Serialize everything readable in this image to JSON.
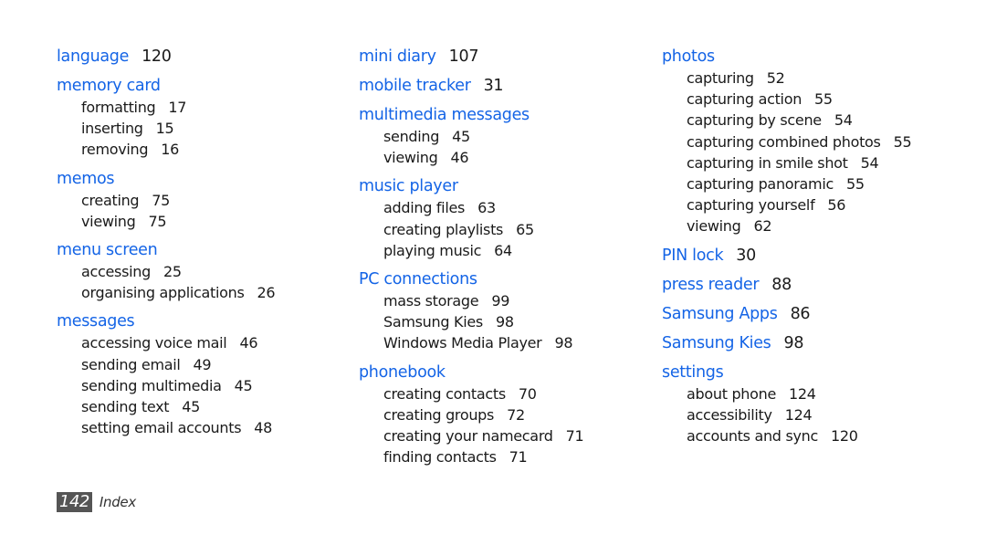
{
  "columns": [
    [
      {
        "term": "language",
        "page": "120",
        "subs": []
      },
      {
        "term": "memory card",
        "page": "",
        "subs": [
          {
            "term": "formatting",
            "page": "17"
          },
          {
            "term": "inserting",
            "page": "15"
          },
          {
            "term": "removing",
            "page": "16"
          }
        ]
      },
      {
        "term": "memos",
        "page": "",
        "subs": [
          {
            "term": "creating",
            "page": "75"
          },
          {
            "term": "viewing",
            "page": "75"
          }
        ]
      },
      {
        "term": "menu screen",
        "page": "",
        "subs": [
          {
            "term": "accessing",
            "page": "25"
          },
          {
            "term": "organising applications",
            "page": "26"
          }
        ]
      },
      {
        "term": "messages",
        "page": "",
        "subs": [
          {
            "term": "accessing voice mail",
            "page": "46"
          },
          {
            "term": "sending email",
            "page": "49"
          },
          {
            "term": "sending multimedia",
            "page": "45"
          },
          {
            "term": "sending text",
            "page": "45"
          },
          {
            "term": "setting email accounts",
            "page": "48"
          }
        ]
      }
    ],
    [
      {
        "term": "mini diary",
        "page": "107",
        "subs": []
      },
      {
        "term": "mobile tracker",
        "page": "31",
        "subs": []
      },
      {
        "term": "multimedia messages",
        "page": "",
        "subs": [
          {
            "term": "sending",
            "page": "45"
          },
          {
            "term": "viewing",
            "page": "46"
          }
        ]
      },
      {
        "term": "music player",
        "page": "",
        "subs": [
          {
            "term": "adding files",
            "page": "63"
          },
          {
            "term": "creating playlists",
            "page": "65"
          },
          {
            "term": "playing music",
            "page": "64"
          }
        ]
      },
      {
        "term": "PC connections",
        "page": "",
        "subs": [
          {
            "term": "mass storage",
            "page": "99"
          },
          {
            "term": "Samsung Kies",
            "page": "98"
          },
          {
            "term": "Windows Media Player",
            "page": "98"
          }
        ]
      },
      {
        "term": "phonebook",
        "page": "",
        "subs": [
          {
            "term": "creating contacts",
            "page": "70"
          },
          {
            "term": "creating groups",
            "page": "72"
          },
          {
            "term": "creating your namecard",
            "page": "71"
          },
          {
            "term": "finding contacts",
            "page": "71"
          }
        ]
      }
    ],
    [
      {
        "term": "photos",
        "page": "",
        "subs": [
          {
            "term": "capturing",
            "page": "52"
          },
          {
            "term": "capturing action",
            "page": "55"
          },
          {
            "term": "capturing by scene",
            "page": "54"
          },
          {
            "term": "capturing combined photos",
            "page": "55"
          },
          {
            "term": "capturing in smile shot",
            "page": "54"
          },
          {
            "term": "capturing panoramic",
            "page": "55"
          },
          {
            "term": "capturing yourself",
            "page": "56"
          },
          {
            "term": "viewing",
            "page": "62"
          }
        ]
      },
      {
        "term": "PIN lock",
        "page": "30",
        "subs": []
      },
      {
        "term": "press reader",
        "page": "88",
        "subs": []
      },
      {
        "term": "Samsung Apps",
        "page": "86",
        "subs": []
      },
      {
        "term": "Samsung Kies",
        "page": "98",
        "subs": []
      },
      {
        "term": "settings",
        "page": "",
        "subs": [
          {
            "term": "about phone",
            "page": "124"
          },
          {
            "term": "accessibility",
            "page": "124"
          },
          {
            "term": "accounts and sync",
            "page": "120"
          }
        ]
      }
    ]
  ],
  "footer": {
    "page_number": "142",
    "section": "Index"
  },
  "colors": {
    "heading": "#1464e6",
    "text": "#1a1a1a",
    "page_badge": "#555555"
  }
}
